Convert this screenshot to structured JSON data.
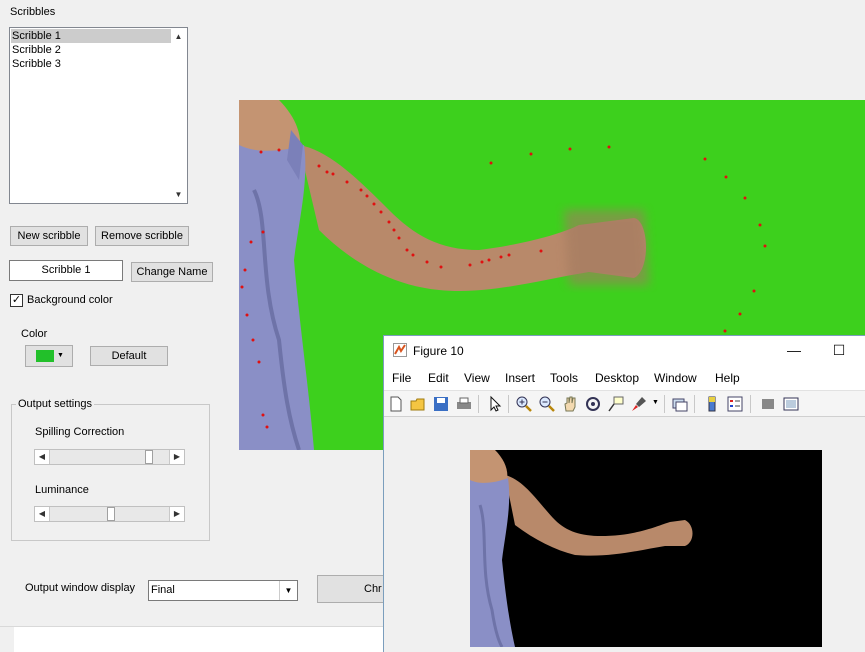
{
  "scribbles": {
    "title": "Scribbles",
    "items": [
      "Scribble 1",
      "Scribble 2",
      "Scribble 3"
    ],
    "selected_index": 0
  },
  "buttons": {
    "new_scribble": "New scribble",
    "remove_scribble": "Remove scribble",
    "change_name": "Change Name",
    "default": "Default",
    "run_partial": "Chr"
  },
  "name_field": {
    "value": "Scribble 1"
  },
  "background_color": {
    "label": "Background color",
    "checked": true
  },
  "color": {
    "label": "Color",
    "swatch": "#22c02a"
  },
  "output_settings": {
    "title": "Output settings",
    "spilling_label": "Spilling Correction",
    "spilling_value": 0.93,
    "luminance_label": "Luminance",
    "luminance_value": 0.5
  },
  "output_display": {
    "label": "Output window display",
    "value": "Final"
  },
  "figure": {
    "title": "Figure 10",
    "menus": [
      "File",
      "Edit",
      "View",
      "Insert",
      "Tools",
      "Desktop",
      "Window",
      "Help"
    ],
    "toolbar_icons": [
      "new-figure-icon",
      "open-file-icon",
      "save-icon",
      "print-icon",
      "pointer-icon",
      "zoom-in-icon",
      "zoom-out-icon",
      "pan-icon",
      "rotate-3d-icon",
      "data-cursor-icon",
      "brush-icon",
      "link-plot-icon",
      "colorbar-icon",
      "legend-icon",
      "hide-plot-tools-icon",
      "show-plot-tools-icon"
    ]
  },
  "colors": {
    "green_screen": "#3dd01d",
    "scribble_dot": "#e01010",
    "dress": "#8a8fc6",
    "skin": "#b8896a",
    "output_bg": "#000000"
  }
}
